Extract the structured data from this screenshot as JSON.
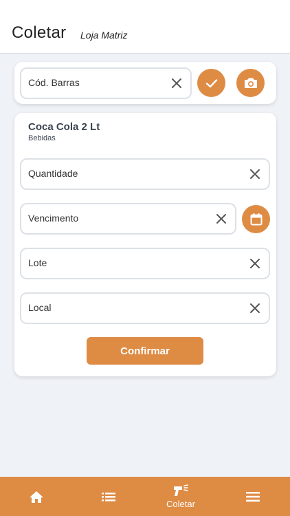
{
  "header": {
    "title": "Coletar",
    "subtitle": "Loja Matriz"
  },
  "barcode": {
    "placeholder": "Cód. Barras",
    "confirm_icon": "check-icon",
    "camera_icon": "camera-icon"
  },
  "product": {
    "name": "Coca Cola 2 Lt",
    "category": "Bebidas"
  },
  "form": {
    "quantity_label": "Quantidade",
    "expiry_label": "Vencimento",
    "lot_label": "Lote",
    "location_label": "Local",
    "calendar_icon": "calendar-icon",
    "confirm_label": "Confirmar"
  },
  "nav": {
    "items": [
      {
        "icon": "home-icon",
        "label": ""
      },
      {
        "icon": "list-icon",
        "label": ""
      },
      {
        "icon": "scanner-icon",
        "label": "Coletar"
      },
      {
        "icon": "menu-icon",
        "label": ""
      }
    ]
  },
  "colors": {
    "accent": "#de8b44",
    "background": "#eff2f6"
  }
}
